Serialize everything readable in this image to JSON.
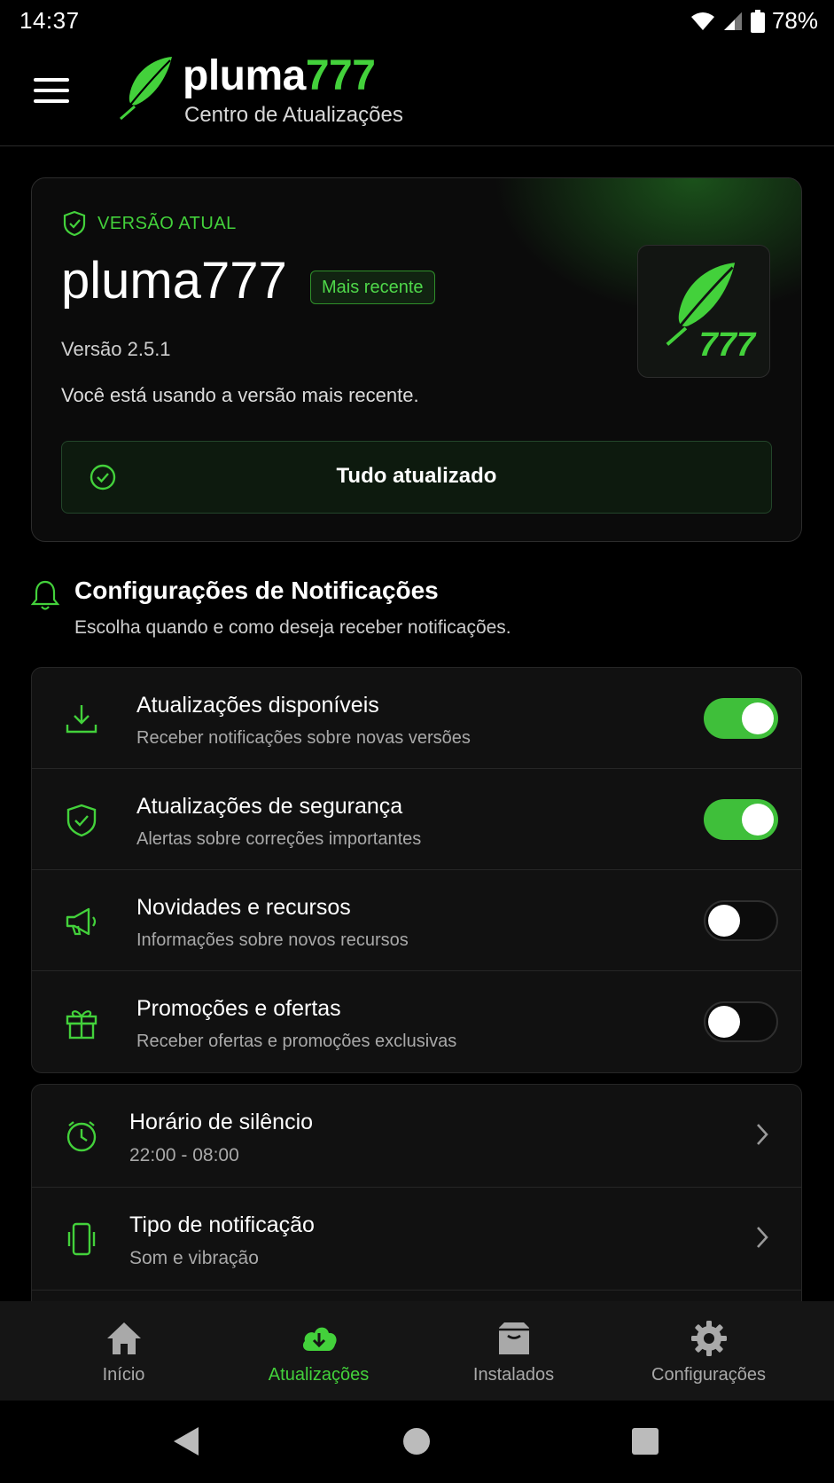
{
  "status_bar": {
    "time": "14:37",
    "battery": "78%"
  },
  "header": {
    "brand_white": "pluma",
    "brand_green": "777",
    "subtitle": "Centro de Atualizações"
  },
  "version_card": {
    "label": "VERSÃO ATUAL",
    "app_name": "pluma777",
    "badge": "Mais recente",
    "version": "Versão 2.5.1",
    "message": "Você está usando a versão mais recente.",
    "status": "Tudo atualizado",
    "logo_number": "777"
  },
  "notifications": {
    "title": "Configurações de Notificações",
    "subtitle": "Escolha quando e como deseja receber notificações.",
    "toggles": [
      {
        "title": "Atualizações disponíveis",
        "subtitle": "Receber notificações sobre novas versões",
        "icon": "download-icon",
        "enabled": true
      },
      {
        "title": "Atualizações de segurança",
        "subtitle": "Alertas sobre correções importantes",
        "icon": "shield-check-icon",
        "enabled": true
      },
      {
        "title": "Novidades e recursos",
        "subtitle": "Informações sobre novos recursos",
        "icon": "megaphone-icon",
        "enabled": false
      },
      {
        "title": "Promoções e ofertas",
        "subtitle": "Receber ofertas e promoções exclusivas",
        "icon": "gift-icon",
        "enabled": false
      }
    ],
    "settings": [
      {
        "title": "Horário de silêncio",
        "value": "22:00 - 08:00",
        "icon": "clock-icon"
      },
      {
        "title": "Tipo de notificação",
        "value": "Som e vibração",
        "icon": "phone-vibrate-icon"
      }
    ]
  },
  "bottom_nav": {
    "items": [
      {
        "label": "Início",
        "icon": "home-icon"
      },
      {
        "label": "Atualizações",
        "icon": "cloud-download-icon",
        "active": true
      },
      {
        "label": "Instalados",
        "icon": "box-icon"
      },
      {
        "label": "Configurações",
        "icon": "gear-icon"
      }
    ]
  },
  "colors": {
    "accent": "#43d13b",
    "background": "#000000",
    "card": "#111111"
  }
}
